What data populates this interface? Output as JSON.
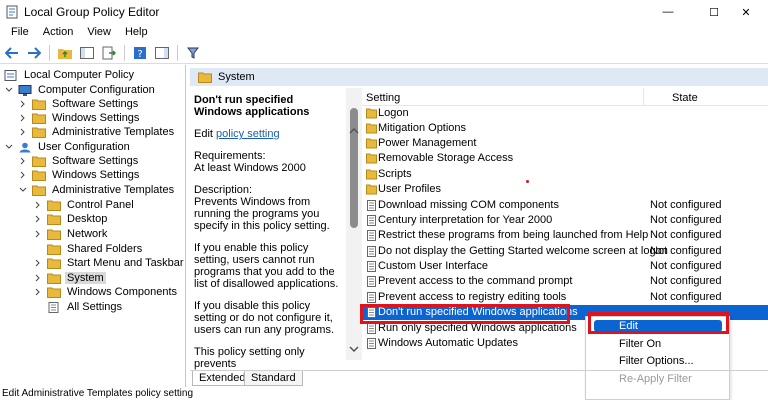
{
  "window": {
    "title": "Local Group Policy Editor",
    "min_glyph": "—",
    "max_glyph": "☐",
    "close_glyph": "✕"
  },
  "menu": [
    "File",
    "Action",
    "View",
    "Help"
  ],
  "tree": {
    "items": [
      {
        "label": "Local Computer Policy"
      },
      {
        "label": "Computer Configuration"
      },
      {
        "label": "Software Settings"
      },
      {
        "label": "Windows Settings"
      },
      {
        "label": "Administrative Templates"
      },
      {
        "label": "User Configuration"
      },
      {
        "label": "Software Settings"
      },
      {
        "label": "Windows Settings"
      },
      {
        "label": "Administrative Templates"
      },
      {
        "label": "Control Panel"
      },
      {
        "label": "Desktop"
      },
      {
        "label": "Network"
      },
      {
        "label": "Shared Folders"
      },
      {
        "label": "Start Menu and Taskbar"
      },
      {
        "label": "System"
      },
      {
        "label": "Windows Components"
      },
      {
        "label": "All Settings"
      }
    ]
  },
  "band": {
    "label": "System"
  },
  "description": {
    "heading": "Don't run specified Windows applications",
    "edit_prefix": "Edit ",
    "edit_link": "policy setting",
    "requirements_label": "Requirements:",
    "requirements_value": "At least Windows 2000",
    "description_label": "Description:",
    "p1": "Prevents Windows from running the programs you specify in this policy setting.",
    "p2": "If you enable this policy setting, users cannot run programs that you add to the list of disallowed applications.",
    "p3": "If you disable this policy setting or do not configure it, users can run any programs.",
    "p4": "This policy setting only prevents"
  },
  "list": {
    "col_setting": "Setting",
    "col_state": "State",
    "rows": [
      {
        "name": "Logon",
        "state": "",
        "kind": "folder"
      },
      {
        "name": "Mitigation Options",
        "state": "",
        "kind": "folder"
      },
      {
        "name": "Power Management",
        "state": "",
        "kind": "folder"
      },
      {
        "name": "Removable Storage Access",
        "state": "",
        "kind": "folder"
      },
      {
        "name": "Scripts",
        "state": "",
        "kind": "folder"
      },
      {
        "name": "User Profiles",
        "state": "",
        "kind": "folder"
      },
      {
        "name": "Download missing COM components",
        "state": "Not configured",
        "kind": "setting"
      },
      {
        "name": "Century interpretation for Year 2000",
        "state": "Not configured",
        "kind": "setting"
      },
      {
        "name": "Restrict these programs from being launched from Help",
        "state": "Not configured",
        "kind": "setting"
      },
      {
        "name": "Do not display the Getting Started welcome screen at logon",
        "state": "Not configured",
        "kind": "setting"
      },
      {
        "name": "Custom User Interface",
        "state": "Not configured",
        "kind": "setting"
      },
      {
        "name": "Prevent access to the command prompt",
        "state": "Not configured",
        "kind": "setting"
      },
      {
        "name": "Prevent access to registry editing tools",
        "state": "Not configured",
        "kind": "setting"
      },
      {
        "name": "Don't run specified Windows applications",
        "state": "",
        "kind": "setting"
      },
      {
        "name": "Run only specified Windows applications",
        "state": "",
        "kind": "setting"
      },
      {
        "name": "Windows Automatic Updates",
        "state": "",
        "kind": "setting"
      }
    ]
  },
  "context_menu": {
    "edit": "Edit",
    "filter_on": "Filter On",
    "filter_options": "Filter Options...",
    "reapply": "Re-Apply Filter"
  },
  "tabs": {
    "extended": "Extended",
    "standard": "Standard"
  },
  "status": "Edit Administrative Templates policy setting",
  "colors": {
    "accent": "#0a64d2",
    "highlight_box": "#e0121c",
    "folder": "#e8b93c"
  }
}
